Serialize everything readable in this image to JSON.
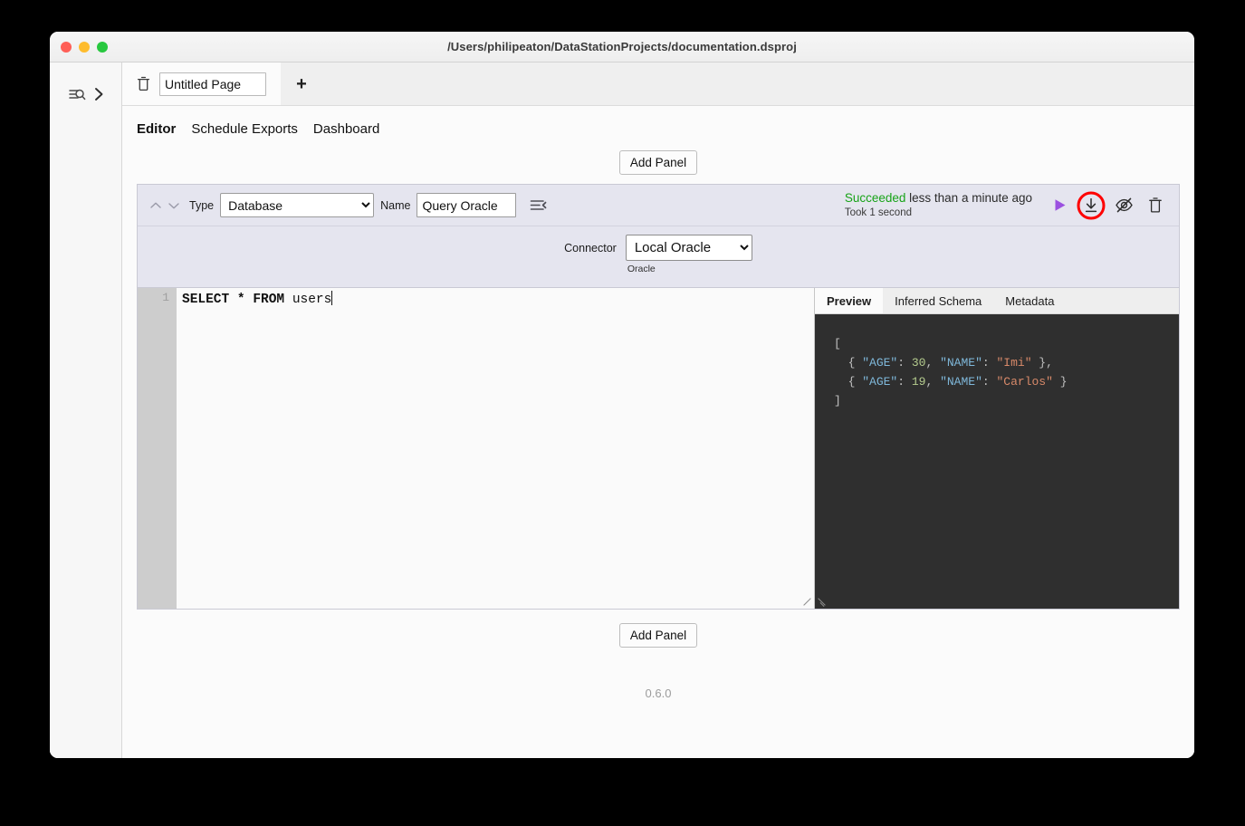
{
  "window": {
    "title": "/Users/philipeaton/DataStationProjects/documentation.dsproj",
    "traffic_lights": [
      "close",
      "minimize",
      "maximize"
    ]
  },
  "sidebar": {
    "search_icon": "list-search-icon",
    "expand_icon": "chevron-right-icon"
  },
  "tabbar": {
    "delete_page_icon": "trash-icon",
    "page_name": "Untitled Page",
    "page_name_placeholder": "Page name",
    "add_page_label": "+"
  },
  "section_nav": {
    "items": [
      {
        "label": "Editor",
        "active": true
      },
      {
        "label": "Schedule Exports",
        "active": false
      },
      {
        "label": "Dashboard",
        "active": false
      }
    ]
  },
  "buttons": {
    "add_panel_top": "Add Panel",
    "add_panel_bottom": "Add Panel"
  },
  "panel": {
    "move_up_icon": "chevron-up-icon",
    "move_down_icon": "chevron-down-icon",
    "type_label": "Type",
    "type_value": "Database",
    "type_options": [
      "Database"
    ],
    "name_label": "Name",
    "name_value": "Query Oracle",
    "name_placeholder": "Panel name",
    "collapse_icon": "collapse-lines-icon",
    "status": {
      "state": "Succeeded",
      "state_color": "#18a318",
      "relative_time": "less than a minute ago",
      "duration": "Took 1 second"
    },
    "actions": {
      "play_icon": "play-icon",
      "play_color": "#9b51e0",
      "download_icon": "download-icon",
      "hide_icon": "eye-off-icon",
      "delete_icon": "trash-icon",
      "highlight_color": "#fe0000",
      "highlighted_action": "download-icon"
    },
    "connector": {
      "label": "Connector",
      "value": "Local Oracle",
      "options": [
        "Local Oracle"
      ],
      "subtitle": "Oracle"
    },
    "editor": {
      "line_numbers": [
        "1"
      ],
      "code_keyword_1": "SELECT * FROM ",
      "code_rest_1": "users"
    },
    "preview": {
      "tabs": [
        {
          "label": "Preview",
          "active": true
        },
        {
          "label": "Inferred Schema",
          "active": false
        },
        {
          "label": "Metadata",
          "active": false
        }
      ],
      "json_lines": {
        "l1": "[",
        "l2_open": "  { ",
        "l2_k1": "\"AGE\"",
        "l2_c1": ": ",
        "l2_v1": "30",
        "l2_sep": ", ",
        "l2_k2": "\"NAME\"",
        "l2_c2": ": ",
        "l2_v2": "\"Imi\"",
        "l2_close": " },",
        "l3_open": "  { ",
        "l3_k1": "\"AGE\"",
        "l3_c1": ": ",
        "l3_v1": "19",
        "l3_sep": ", ",
        "l3_k2": "\"NAME\"",
        "l3_c2": ": ",
        "l3_v2": "\"Carlos\"",
        "l3_close": " }",
        "l4": "]"
      }
    }
  },
  "footer": {
    "version": "0.6.0"
  }
}
